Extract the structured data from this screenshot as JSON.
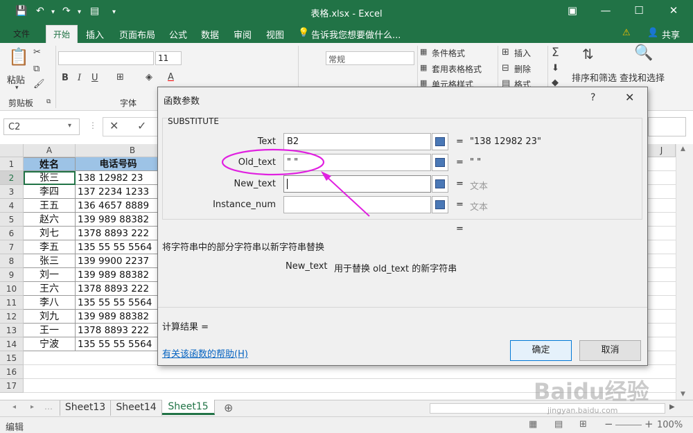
{
  "window": {
    "title": "表格.xlsx - Excel"
  },
  "ribbon_tabs": [
    "文件",
    "开始",
    "插入",
    "页面布局",
    "公式",
    "数据",
    "审阅",
    "视图"
  ],
  "tell_me": "告诉我您想要做什么...",
  "share": "共享",
  "ribbon": {
    "paste": "粘贴",
    "clipboard": "剪贴板",
    "font_group": "字体",
    "font_size": "11",
    "number_format": "常规",
    "cond_format": "条件格式",
    "table_format": "套用表格格式",
    "cell_style": "单元格样式",
    "insert": "插入",
    "delete": "删除",
    "format": "格式",
    "sort_filter": "排序和筛选",
    "find_select": "查找和选择"
  },
  "name_box": "C2",
  "columns": [
    "A",
    "B",
    "J"
  ],
  "rows": [
    {
      "n": "1",
      "a": "姓名",
      "b": "电话号码"
    },
    {
      "n": "2",
      "a": "张三",
      "b": "138  12982 23"
    },
    {
      "n": "3",
      "a": "李四",
      "b": "137 2234  1233"
    },
    {
      "n": "4",
      "a": "王五",
      "b": "136 4657 8889"
    },
    {
      "n": "5",
      "a": "赵六",
      "b": "139 989 88382"
    },
    {
      "n": "6",
      "a": "刘七",
      "b": "1378   8893 222"
    },
    {
      "n": "7",
      "a": "李五",
      "b": "135 55 55  5564"
    },
    {
      "n": "8",
      "a": "张三",
      "b": "139   9900  2237"
    },
    {
      "n": "9",
      "a": "刘一",
      "b": "139 989 88382"
    },
    {
      "n": "10",
      "a": "王六",
      "b": "1378   8893 222"
    },
    {
      "n": "11",
      "a": "李八",
      "b": "135 55 55  5564"
    },
    {
      "n": "12",
      "a": "刘九",
      "b": "139 989 88382"
    },
    {
      "n": "13",
      "a": "王一",
      "b": "1378   8893 222"
    },
    {
      "n": "14",
      "a": "宁波",
      "b": "135 55 55  5564"
    },
    {
      "n": "15",
      "a": "",
      "b": ""
    },
    {
      "n": "16",
      "a": "",
      "b": ""
    },
    {
      "n": "17",
      "a": "",
      "b": ""
    }
  ],
  "sheets": [
    "Sheet13",
    "Sheet14",
    "Sheet15"
  ],
  "status": {
    "mode": "编辑",
    "zoom": "100%"
  },
  "dialog": {
    "title": "函数参数",
    "help_q": "?",
    "function": "SUBSTITUTE",
    "args": [
      {
        "label": "Text",
        "value": "B2",
        "result": "\"138  12982 23\"",
        "gray": false
      },
      {
        "label": "Old_text",
        "value": "\" \"",
        "result": "\" \"",
        "gray": false
      },
      {
        "label": "New_text",
        "value": "",
        "result": "文本",
        "gray": true
      },
      {
        "label": "Instance_num",
        "value": "",
        "result": "文本",
        "gray": true
      }
    ],
    "description": "将字符串中的部分字符串以新字符串替换",
    "arg_help_name": "New_text",
    "arg_help": "用于替换 old_text 的新字符串",
    "result_label": "计算结果 =",
    "help_link": "有关该函数的帮助(H)",
    "ok": "确定",
    "cancel": "取消"
  },
  "watermark": {
    "brand": "Baidu经验",
    "url": "jingyan.baidu.com"
  },
  "colors": {
    "excel_green": "#217346",
    "header_fill": "#9dc3e6",
    "annotation": "#e020e0"
  }
}
